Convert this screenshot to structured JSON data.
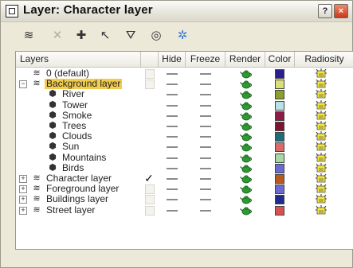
{
  "window": {
    "title": "Layer: Character layer",
    "help_label": "?",
    "close_label": "×"
  },
  "toolbar": [
    {
      "name": "create-layer-icon",
      "glyph": "≋",
      "disabled": false
    },
    {
      "name": "delete-layer-icon",
      "glyph": "✕",
      "disabled": true
    },
    {
      "name": "add-to-layer-icon",
      "glyph": "✚",
      "disabled": false
    },
    {
      "name": "select-objects-icon",
      "glyph": "↖",
      "disabled": false
    },
    {
      "name": "select-layer-icon",
      "glyph": "⛛",
      "disabled": false
    },
    {
      "name": "set-current-layer-icon",
      "glyph": "◎",
      "disabled": false
    },
    {
      "name": "hide-unhide-all-icon",
      "glyph": "✲",
      "disabled": false
    }
  ],
  "columns": {
    "layers": "Layers",
    "hide": "Hide",
    "freeze": "Freeze",
    "render": "Render",
    "color": "Color",
    "radiosity": "Radiosity"
  },
  "rows": [
    {
      "label": "0 (default)",
      "type": "layer",
      "expander": "",
      "current": "box",
      "color": "#2a1f8c",
      "selected": false
    },
    {
      "label": "Background layer",
      "type": "layer",
      "expander": "−",
      "current": "box",
      "color": "#d9e07a",
      "selected": true
    },
    {
      "label": "River",
      "type": "object",
      "current": "",
      "color": "#8aa02c",
      "selected": false
    },
    {
      "label": "Tower",
      "type": "object",
      "current": "",
      "color": "#b8e2e6",
      "selected": false
    },
    {
      "label": "Smoke",
      "type": "object",
      "current": "",
      "color": "#8c1c44",
      "selected": false
    },
    {
      "label": "Trees",
      "type": "object",
      "current": "",
      "color": "#7c1430",
      "selected": false
    },
    {
      "label": "Clouds",
      "type": "object",
      "current": "",
      "color": "#1e6c7a",
      "selected": false
    },
    {
      "label": "Sun",
      "type": "object",
      "current": "",
      "color": "#d86a6a",
      "selected": false
    },
    {
      "label": "Mountains",
      "type": "object",
      "current": "",
      "color": "#a8d8a8",
      "selected": false
    },
    {
      "label": "Birds",
      "type": "object",
      "current": "",
      "color": "#6a6ad0",
      "selected": false
    },
    {
      "label": "Character layer",
      "type": "layer",
      "expander": "+",
      "current": "check",
      "color": "#b85a1e",
      "selected": false
    },
    {
      "label": "Foreground layer",
      "type": "layer",
      "expander": "+",
      "current": "box",
      "color": "#6a6ad0",
      "selected": false
    },
    {
      "label": "Buildings layer",
      "type": "layer",
      "expander": "+",
      "current": "box",
      "color": "#1e2a8c",
      "selected": false
    },
    {
      "label": "Street layer",
      "type": "layer",
      "expander": "+",
      "current": "box",
      "color": "#d85050",
      "selected": false
    }
  ],
  "check_glyph": "✓"
}
